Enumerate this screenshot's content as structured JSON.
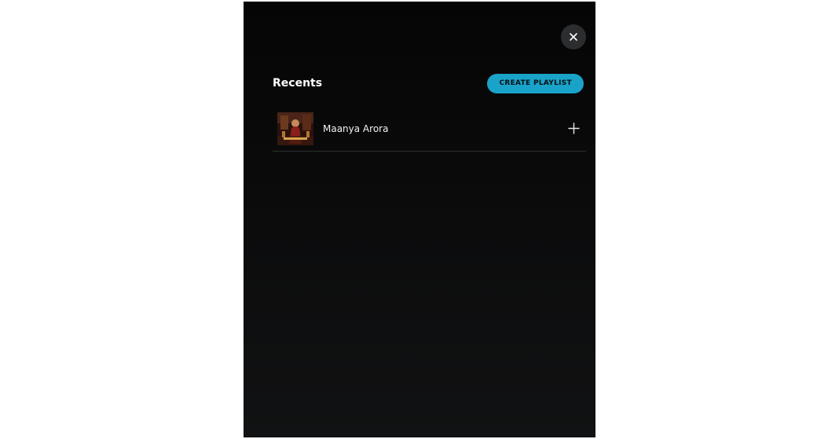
{
  "dialog": {
    "close_icon": "close-icon",
    "section_title": "Recents",
    "create_playlist_label": "CREATE PLAYLIST",
    "accent_color": "#1aa3c9"
  },
  "recents": {
    "items": [
      {
        "label": "Maanya Arora",
        "thumbnail_icon": "album-art-icon",
        "action_icon": "plus-icon"
      }
    ]
  }
}
